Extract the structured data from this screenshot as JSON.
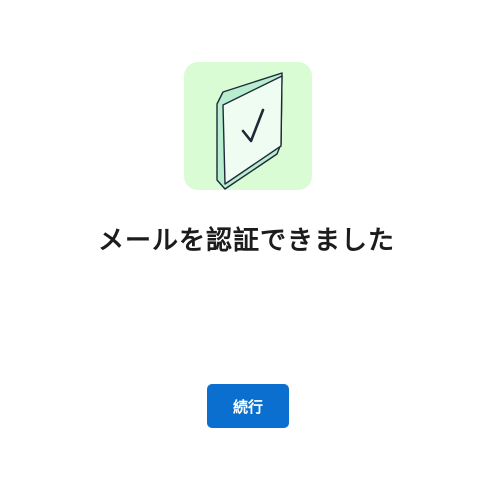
{
  "illustration": {
    "icon": "verified-checkbox-icon",
    "background_color": "#d9fcd4"
  },
  "title": "メールを認証できました",
  "continue_label": "続行",
  "colors": {
    "accent": "#0a6fce",
    "text": "#1c1c1c"
  }
}
